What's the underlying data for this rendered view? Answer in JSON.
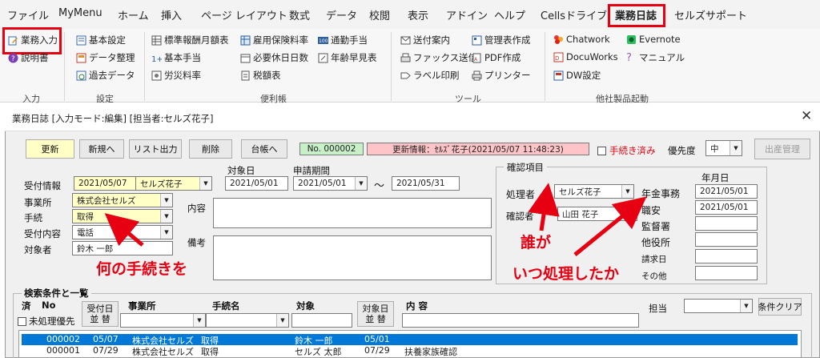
{
  "menu": [
    "ファイル",
    "MyMenu",
    "ホーム",
    "挿入",
    "ページ レイアウト",
    "数式",
    "データ",
    "校閲",
    "表示",
    "アドイン",
    "ヘルプ",
    "Cellsドライブ",
    "業務日誌",
    "セルズサポート"
  ],
  "ribbon": {
    "input": [
      "業務入力",
      "説明書"
    ],
    "settings": [
      "基本設定",
      "データ整理",
      "過去データ"
    ],
    "useful1": [
      "標準報酬月額表",
      "基本手当",
      "労災料率"
    ],
    "useful2": [
      "雇用保険料率",
      "必要休日日数",
      "税額表"
    ],
    "useful3": [
      "通勤手当",
      "年齢早見表"
    ],
    "tools1": [
      "送付案内",
      "ファックス送信",
      "ラベル印刷"
    ],
    "tools2": [
      "管理表作成",
      "PDF作成",
      "プリンター"
    ],
    "other1": [
      "Chatwork",
      "DocuWorks",
      "DW設定"
    ],
    "other2": [
      "Evernote",
      "マニュアル"
    ],
    "groups": [
      "入力",
      "設定",
      "便利帳",
      "ツール",
      "他社製品起動"
    ]
  },
  "dialog": {
    "title": "業務日誌 [入力モード:編集] [担当者:セルズ花子]",
    "buttons": [
      "更新",
      "新規へ",
      "リスト出力",
      "削除",
      "台帳へ"
    ],
    "record_no": "No. 000002",
    "update_info": "更新情報：ｾﾙｽﾞ花子(2021/05/07 11:48:23)",
    "procedure_done": "手続き済み",
    "priority_label": "優先度",
    "priority_value": "中",
    "issue_button": "出産管理",
    "reception_label": "受付情報",
    "reception_date": "2021/05/07",
    "reception_person": "セルズ花子",
    "target_date_label": "対象日",
    "target_date": "2021/05/01",
    "period_label": "申請期間",
    "period_start": "2021/05/01",
    "period_tilde": "～",
    "period_end": "2021/05/31",
    "office_label": "事業所",
    "office_value": "株式会社セルズ",
    "procedure_label": "手続",
    "procedure_value": "取得",
    "content_type_label": "受付内容",
    "content_type_value": "電話",
    "person_label": "対象者",
    "person_value": "鈴木 一郎",
    "content_label": "内容",
    "remarks_label": "備考",
    "confirm_title": "確認項目",
    "handler_label": "処理者",
    "handler_value": "セルズ花子",
    "checker_label": "確認者",
    "checker_value": "山田 花子",
    "ym_header": "年月日",
    "confirm_items": [
      {
        "label": "年金事務",
        "date": "2021/05/01"
      },
      {
        "label": "職安",
        "date": "2021/05/01"
      },
      {
        "label": "監督署",
        "date": ""
      },
      {
        "label": "他役所",
        "date": ""
      },
      {
        "label": "請求日",
        "date": ""
      },
      {
        "label": "その他",
        "date": ""
      }
    ]
  },
  "annotations": {
    "what_procedure": "何の手続きを",
    "who": "誰が",
    "when": "いつ処理したか"
  },
  "search": {
    "title": "検索条件と一覧",
    "col_done": "済",
    "col_no": "No",
    "sort_reception_1": "受付日",
    "sort_reception_2": "並 替",
    "col_office": "事業所",
    "col_procedure": "手続名",
    "col_person": "対象",
    "sort_target_1": "対象日",
    "sort_target_2": "並 替",
    "col_content": "内 容",
    "col_staff": "担当",
    "unprocessed_label": "未処理優先",
    "clear_button": "条件クリア"
  },
  "rows": [
    {
      "no": "000002",
      "date": "05/07",
      "office": "株式会社セルズ",
      "proc": "取得",
      "person": "鈴木 一郎",
      "tdate": "05/01",
      "content": ""
    },
    {
      "no": "000001",
      "date": "07/29",
      "office": "株式会社セルズ",
      "proc": "取得",
      "person": "セルズ 太郎",
      "tdate": "07/29",
      "content": "扶養家族確認"
    }
  ],
  "colors": {
    "accent_red": "#e60012",
    "selected_row": "#0078d7",
    "yellow_field": "#ffffc6"
  }
}
